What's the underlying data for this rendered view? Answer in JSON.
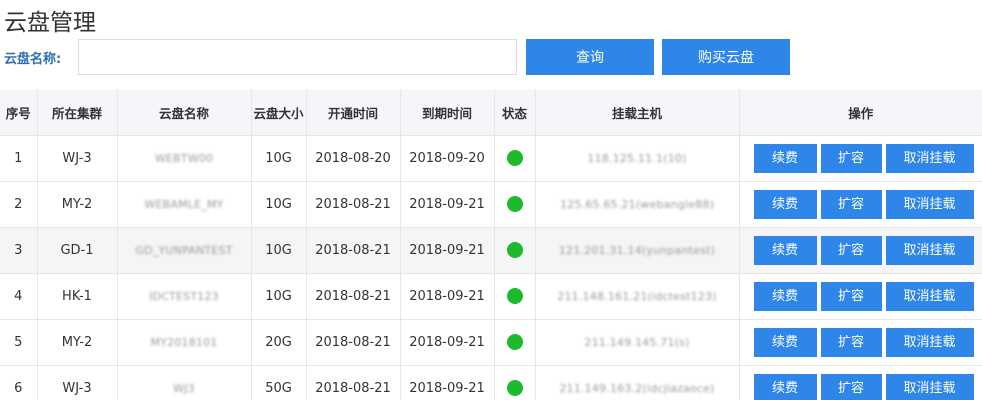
{
  "page": {
    "title": "云盘管理"
  },
  "search": {
    "label": "云盘名称:",
    "value": "",
    "placeholder": ""
  },
  "buttons": {
    "query": "查询",
    "buy": "购买云盘"
  },
  "table": {
    "headers": [
      "序号",
      "所在集群",
      "云盘名称",
      "云盘大小",
      "开通时间",
      "到期时间",
      "状态",
      "挂载主机",
      "操作"
    ],
    "ops": {
      "renew": "续费",
      "expand": "扩容",
      "unmount": "取消挂载"
    },
    "status_color": "#1db92e",
    "rows": [
      {
        "no": "1",
        "cluster": "WJ-3",
        "name": "WEBTW00",
        "size": "10G",
        "open": "2018-08-20",
        "expire": "2018-09-20",
        "host": "118.125.11.1(10)"
      },
      {
        "no": "2",
        "cluster": "MY-2",
        "name": "WEBAMLE_MY",
        "size": "10G",
        "open": "2018-08-21",
        "expire": "2018-09-21",
        "host": "125.65.65.21(webangle88)"
      },
      {
        "no": "3",
        "cluster": "GD-1",
        "name": "GD_YUNPANTEST",
        "size": "10G",
        "open": "2018-08-21",
        "expire": "2018-09-21",
        "host": "121.201.31.14(yunpantest)"
      },
      {
        "no": "4",
        "cluster": "HK-1",
        "name": "IDCTEST123",
        "size": "10G",
        "open": "2018-08-21",
        "expire": "2018-09-21",
        "host": "211.148.161.21(idctest123)"
      },
      {
        "no": "5",
        "cluster": "MY-2",
        "name": "MY2018101",
        "size": "20G",
        "open": "2018-08-21",
        "expire": "2018-09-21",
        "host": "211.149.145.71(s)"
      },
      {
        "no": "6",
        "cluster": "WJ-3",
        "name": "WJ3",
        "size": "50G",
        "open": "2018-08-21",
        "expire": "2018-09-21",
        "host": "211.149.163.2(idcjiazaoce)"
      }
    ]
  }
}
